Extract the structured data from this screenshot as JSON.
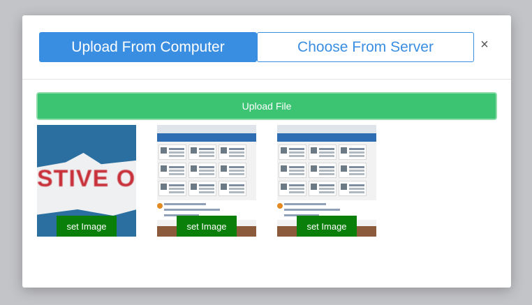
{
  "tabs": {
    "upload_from_computer": "Upload From Computer",
    "choose_from_server": "Choose From Server"
  },
  "close_symbol": "×",
  "upload_button": "Upload File",
  "thumbnails": [
    {
      "set_label": "set Image",
      "preview_text": "STIVE O"
    },
    {
      "set_label": "set Image"
    },
    {
      "set_label": "set Image"
    }
  ],
  "colors": {
    "primary_blue": "#3a8ee2",
    "upload_green": "#3cc473",
    "set_image_green": "#0a7f0a"
  }
}
